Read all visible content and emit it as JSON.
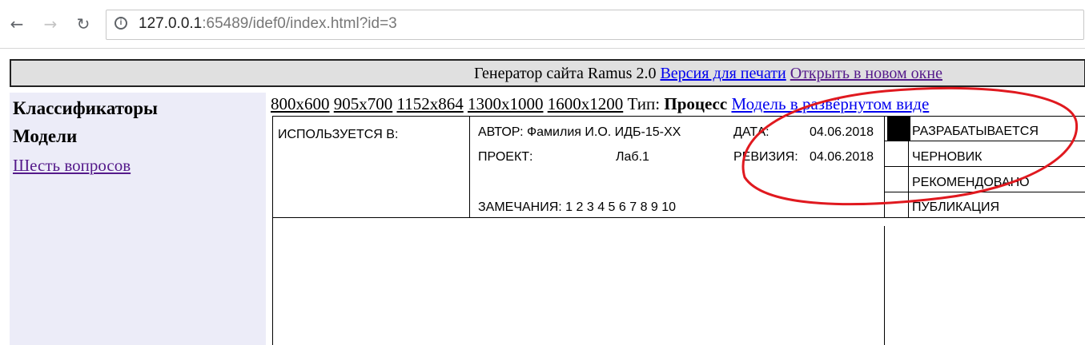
{
  "browser": {
    "url_host": "127.0.0.1",
    "url_rest": ":65489/idef0/index.html?id=3"
  },
  "header": {
    "title": "Генератор сайта Ramus 2.0",
    "print_link": "Версия для печати",
    "new_window_link": "Открыть в новом окне"
  },
  "sidebar": {
    "heading1": "Классификаторы",
    "heading2": "Модели",
    "link": "Шесть вопросов"
  },
  "sizes": {
    "items": [
      "800x600",
      "905x700",
      "1152x864",
      "1300x1000",
      "1600x1200"
    ],
    "type_label": "Тип:",
    "type_value": "Процесс",
    "expanded_link": "Модель в развёрнутом виде"
  },
  "idef0": {
    "used_in": "ИСПОЛЬЗУЕТСЯ В:",
    "author": "АВТОР: Фамилия И.О. ИДБ-15-ХХ",
    "project_label": "ПРОЕКТ:",
    "project_value": "Лаб.1",
    "notes": "ЗАМЕЧАНИЯ:  1  2  3  4  5  6  7  8  9  10",
    "date_label": "ДАТА:",
    "date_value": "04.06.2018",
    "revision_label": "РЕВИЗИЯ:",
    "revision_value": "04.06.2018",
    "statuses": [
      "РАЗРАБАТЫВАЕТСЯ",
      "ЧЕРНОВИК",
      "РЕКОМЕНДОВАНО",
      "ПУБЛИКАЦИЯ"
    ]
  },
  "colors": {
    "annotation": "#e0191f",
    "link": "#0000ee",
    "visited": "#551a8b",
    "sidebar_bg": "#ececf8",
    "header_bg": "#e0e0e0"
  }
}
